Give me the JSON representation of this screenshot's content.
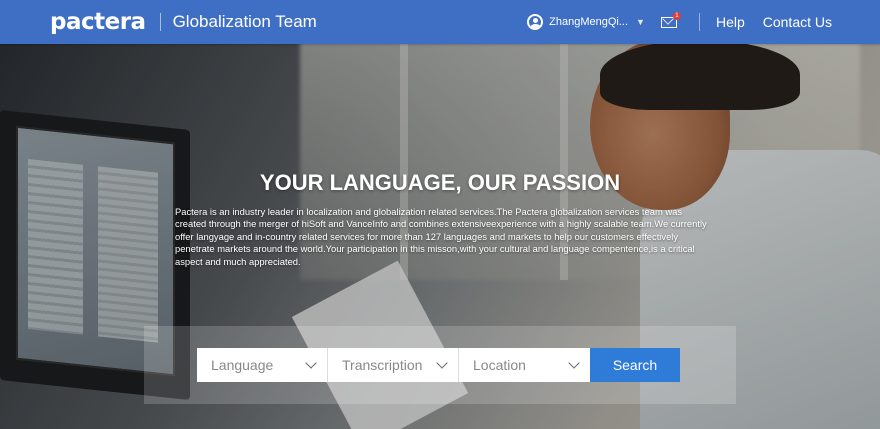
{
  "header": {
    "logo": "pactera",
    "team_name": "Globalization Team",
    "username": "ZhangMengQi...",
    "mail_badge": "1",
    "nav": {
      "help": "Help",
      "contact": "Contact Us"
    }
  },
  "hero": {
    "title": "YOUR LANGUAGE, OUR PASSION",
    "body": "Pactera is an industry leader in localization and globalization related services.The Pactera globalization services team was created through the merger of hiSoft and VanceInfo and combines extensiveexperience with a highly scalable team.We currently offer langyage and in-country related services for more than 127 languages and markets to help our customers effectively penetrate markets around the world.Your participation in this misson,with your cultural and language compentence,is a critical aspect and much appreciated."
  },
  "search": {
    "language_placeholder": "Language",
    "transcription_placeholder": "Transcription",
    "location_placeholder": "Location",
    "button": "Search"
  },
  "colors": {
    "header_bg": "#3f6fc4",
    "search_button": "#2f7bd8",
    "badge": "#e23b3b"
  }
}
